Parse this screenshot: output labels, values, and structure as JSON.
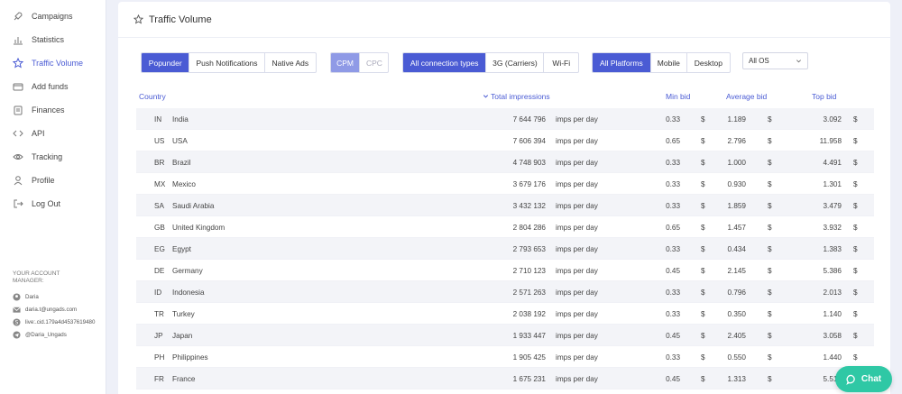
{
  "sidebar": {
    "items": [
      {
        "label": "Campaigns",
        "icon": "rocket-icon"
      },
      {
        "label": "Statistics",
        "icon": "bar-chart-icon"
      },
      {
        "label": "Traffic Volume",
        "icon": "star-icon"
      },
      {
        "label": "Add funds",
        "icon": "credit-card-icon"
      },
      {
        "label": "Finances",
        "icon": "finance-icon"
      },
      {
        "label": "API",
        "icon": "api-icon"
      },
      {
        "label": "Tracking",
        "icon": "eye-icon"
      },
      {
        "label": "Profile",
        "icon": "user-icon"
      },
      {
        "label": "Log Out",
        "icon": "logout-icon"
      }
    ],
    "active": "Traffic Volume",
    "manager": {
      "title": "YOUR ACCOUNT MANAGER:",
      "name": "Daria",
      "email": "daria.t@ungads.com",
      "skype": "live:.cid.179a4d4537619480",
      "telegram": "@Daria_Ungads"
    }
  },
  "page": {
    "title": "Traffic Volume"
  },
  "filters": {
    "ad_format": [
      "Popunder",
      "Push Notifications",
      "Native Ads"
    ],
    "pricing": [
      "CPM",
      "CPC"
    ],
    "connection": [
      "All connection types",
      "3G (Carriers)",
      "Wi-Fi"
    ],
    "platform": [
      "All Platforms",
      "Mobile",
      "Desktop"
    ],
    "os_selected": "All OS"
  },
  "table": {
    "headers": {
      "country": "Country",
      "total": "Total impressions",
      "min": "Min bid",
      "avg": "Average bid",
      "top": "Top bid"
    },
    "unit_label": "imps per day",
    "currency": "$",
    "rows": [
      {
        "code": "IN",
        "country": "India",
        "imps": "7 644 796",
        "min": "0.33",
        "avg": "1.189",
        "top": "3.092"
      },
      {
        "code": "US",
        "country": "USA",
        "imps": "7 606 394",
        "min": "0.65",
        "avg": "2.796",
        "top": "11.958"
      },
      {
        "code": "BR",
        "country": "Brazil",
        "imps": "4 748 903",
        "min": "0.33",
        "avg": "1.000",
        "top": "4.491"
      },
      {
        "code": "MX",
        "country": "Mexico",
        "imps": "3 679 176",
        "min": "0.33",
        "avg": "0.930",
        "top": "1.301"
      },
      {
        "code": "SA",
        "country": "Saudi Arabia",
        "imps": "3 432 132",
        "min": "0.33",
        "avg": "1.859",
        "top": "3.479"
      },
      {
        "code": "GB",
        "country": "United Kingdom",
        "imps": "2 804 286",
        "min": "0.65",
        "avg": "1.457",
        "top": "3.932"
      },
      {
        "code": "EG",
        "country": "Egypt",
        "imps": "2 793 653",
        "min": "0.33",
        "avg": "0.434",
        "top": "1.383"
      },
      {
        "code": "DE",
        "country": "Germany",
        "imps": "2 710 123",
        "min": "0.45",
        "avg": "2.145",
        "top": "5.386"
      },
      {
        "code": "ID",
        "country": "Indonesia",
        "imps": "2 571 263",
        "min": "0.33",
        "avg": "0.796",
        "top": "2.013"
      },
      {
        "code": "TR",
        "country": "Turkey",
        "imps": "2 038 192",
        "min": "0.33",
        "avg": "0.350",
        "top": "1.140"
      },
      {
        "code": "JP",
        "country": "Japan",
        "imps": "1 933 447",
        "min": "0.45",
        "avg": "2.405",
        "top": "3.058"
      },
      {
        "code": "PH",
        "country": "Philippines",
        "imps": "1 905 425",
        "min": "0.33",
        "avg": "0.550",
        "top": "1.440"
      },
      {
        "code": "FR",
        "country": "France",
        "imps": "1 675 231",
        "min": "0.45",
        "avg": "1.313",
        "top": "5.512"
      }
    ]
  },
  "chat": {
    "label": "Chat"
  },
  "colors": {
    "accent": "#4a5bd4",
    "accent_light": "#8f9ae6",
    "chat": "#2fc8a5",
    "background": "#eef0f8"
  }
}
